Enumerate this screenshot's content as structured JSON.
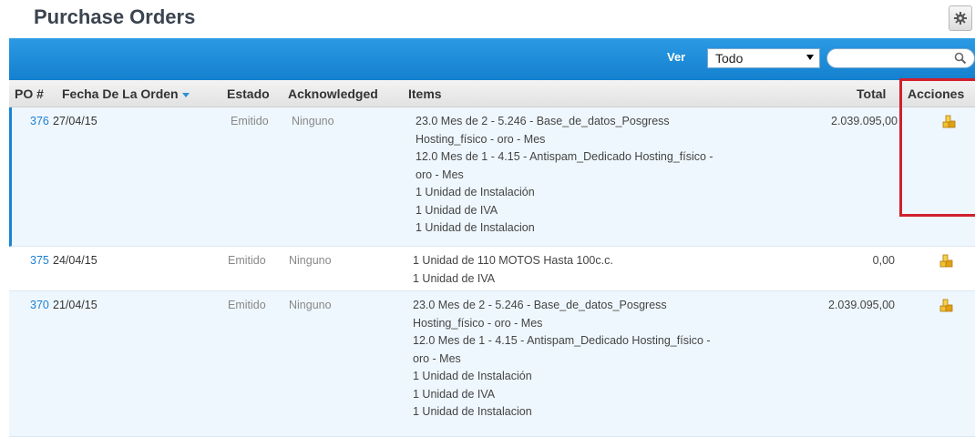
{
  "page": {
    "title": "Purchase Orders"
  },
  "toolbar": {
    "ver_label": "Ver",
    "filter_value": "Todo",
    "search_value": ""
  },
  "table": {
    "headers": {
      "po": "PO #",
      "fecha": "Fecha De La Orden",
      "estado": "Estado",
      "ack": "Acknowledged",
      "items": "Items",
      "total": "Total",
      "acciones": "Acciones"
    },
    "rows": [
      {
        "po": "376",
        "fecha": "27/04/15",
        "estado": "Emitido",
        "ack": "Ninguno",
        "items": [
          "23.0 Mes de 2 - 5.246 - Base_de_datos_Posgress",
          "Hosting_físico - oro - Mes",
          "12.0 Mes de 1 - 4.15 - Antispam_Dedicado Hosting_físico -",
          "oro - Mes",
          "1 Unidad de Instalación",
          "1 Unidad de IVA",
          "1 Unidad de Instalacion"
        ],
        "total": "2.039.095,00"
      },
      {
        "po": "375",
        "fecha": "24/04/15",
        "estado": "Emitido",
        "ack": "Ninguno",
        "items": [
          "1 Unidad de 110 MOTOS Hasta 100c.c.",
          "1 Unidad de IVA"
        ],
        "total": "0,00"
      },
      {
        "po": "370",
        "fecha": "21/04/15",
        "estado": "Emitido",
        "ack": "Ninguno",
        "items": [
          "23.0 Mes de 2 - 5.246 - Base_de_datos_Posgress",
          "Hosting_físico - oro - Mes",
          "12.0 Mes de 1 - 4.15 - Antispam_Dedicado Hosting_físico -",
          "oro - Mes",
          "1 Unidad de Instalación",
          "1 Unidad de IVA",
          "1 Unidad de Instalacion"
        ],
        "total": "2.039.095,00"
      }
    ]
  },
  "colors": {
    "toolbar": "#1b8ad9",
    "link": "#1f7fcf",
    "highlight": "#d0202c",
    "row_alt": "#eef7fd"
  },
  "icons": {
    "settings": "gear-icon",
    "search": "search-icon",
    "action": "coins-icon"
  }
}
